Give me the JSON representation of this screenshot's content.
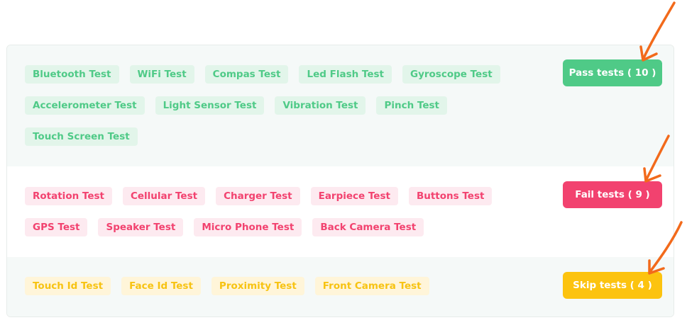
{
  "pass": {
    "button_label": "Pass tests ( 10 )",
    "color": "#4fca87",
    "rows": [
      [
        "Bluetooth Test",
        "WiFi Test",
        "Compas Test",
        "Led Flash Test",
        "Gyroscope Test"
      ],
      [
        "Accelerometer Test",
        "Light Sensor Test",
        "Vibration Test",
        "Pinch Test"
      ],
      [
        "Touch Screen Test"
      ]
    ]
  },
  "fail": {
    "button_label": "Fail tests ( 9 )",
    "color": "#f2426f",
    "rows": [
      [
        "Rotation Test",
        "Cellular Test",
        "Charger Test",
        "Earpiece Test",
        "Buttons Test"
      ],
      [
        "GPS Test",
        "Speaker Test",
        "Micro Phone Test",
        "Back Camera Test"
      ]
    ]
  },
  "skip": {
    "button_label": "Skip tests ( 4 )",
    "color": "#fcc30f",
    "rows": [
      [
        "Touch Id Test",
        "Face Id Test",
        "Proximity Test",
        "Front Camera Test"
      ]
    ]
  },
  "annotation_color": "#f26a1b"
}
